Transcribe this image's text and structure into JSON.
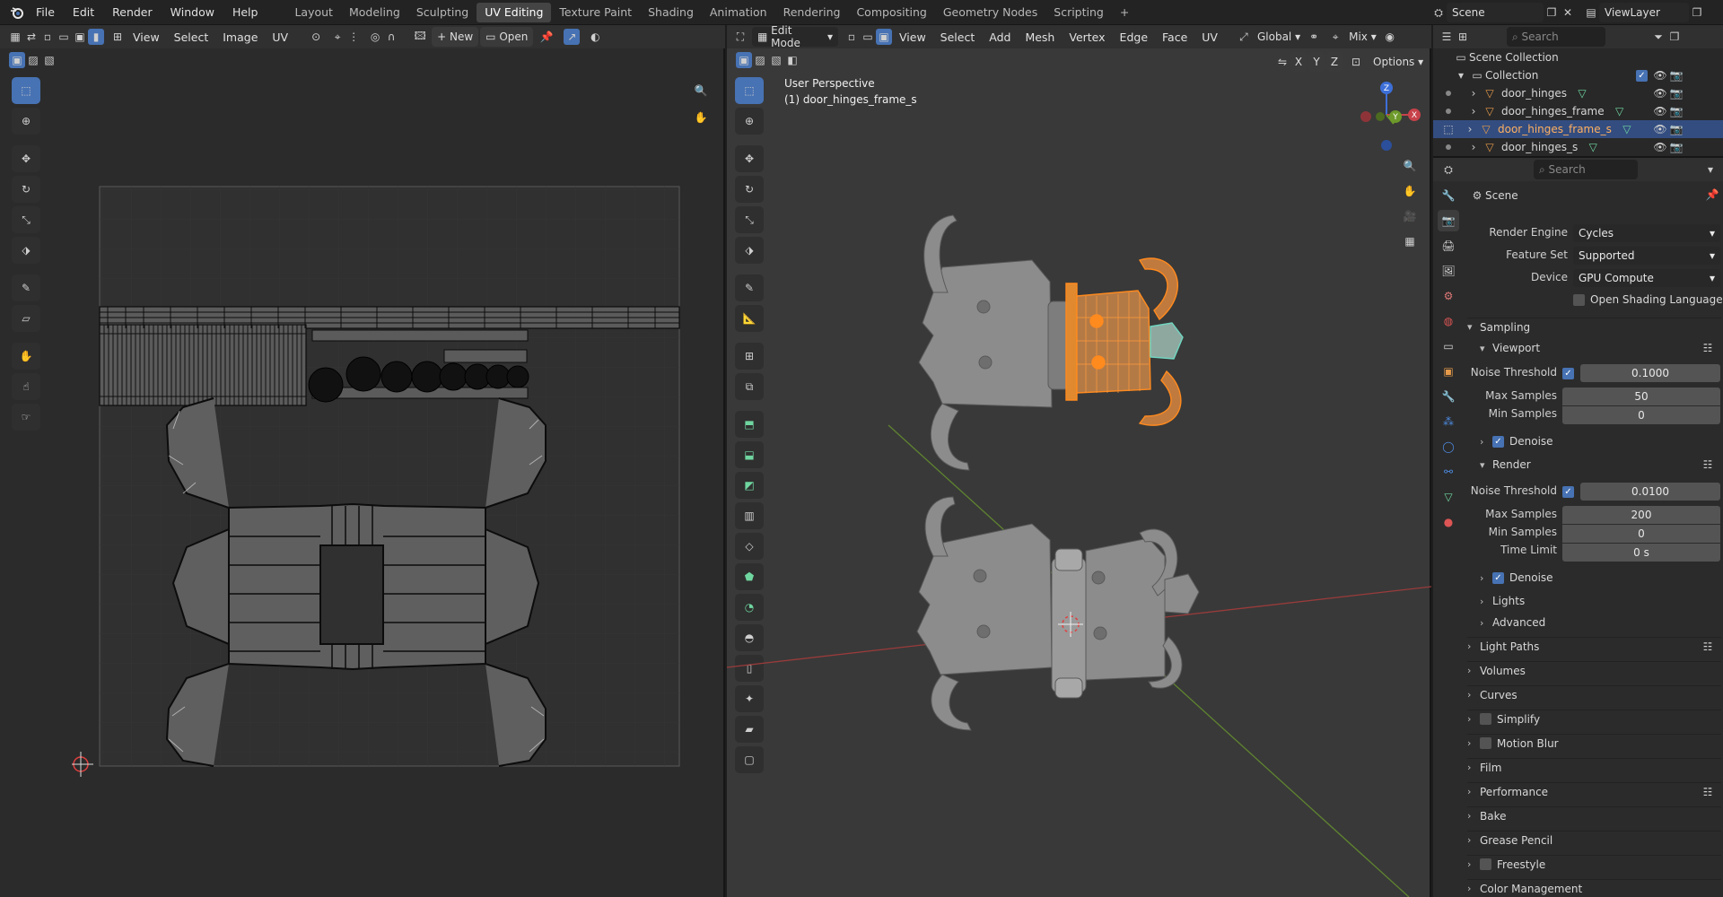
{
  "app": {
    "menus": [
      "File",
      "Edit",
      "Render",
      "Window",
      "Help"
    ],
    "workspaces": [
      "Layout",
      "Modeling",
      "Sculpting",
      "UV Editing",
      "Texture Paint",
      "Shading",
      "Animation",
      "Rendering",
      "Compositing",
      "Geometry Nodes",
      "Scripting"
    ],
    "active_workspace": "UV Editing",
    "scene_name": "Scene",
    "view_layer": "ViewLayer"
  },
  "uv_editor": {
    "menus": [
      "View",
      "Select",
      "Image",
      "UV"
    ],
    "new_label": "New",
    "open_label": "Open"
  },
  "viewport": {
    "mode": "Edit Mode",
    "menus": [
      "View",
      "Select",
      "Add",
      "Mesh",
      "Vertex",
      "Edge",
      "Face",
      "UV"
    ],
    "orientation": "Global",
    "shading": "Mix",
    "options_label": "Options",
    "axis_x": "X",
    "axis_y": "Y",
    "axis_z": "Z",
    "overlay_line1": "User Perspective",
    "overlay_line2": "(1) door_hinges_frame_s"
  },
  "outliner": {
    "search_placeholder": "Search",
    "root": "Scene Collection",
    "collection": "Collection",
    "items": [
      {
        "name": "door_hinges",
        "selected": false
      },
      {
        "name": "door_hinges_frame",
        "selected": false
      },
      {
        "name": "door_hinges_frame_s",
        "selected": true
      },
      {
        "name": "door_hinges_s",
        "selected": false
      }
    ]
  },
  "properties": {
    "search_placeholder": "Search",
    "context": "Scene",
    "render_engine_label": "Render Engine",
    "render_engine": "Cycles",
    "feature_set_label": "Feature Set",
    "feature_set": "Supported",
    "device_label": "Device",
    "device": "GPU Compute",
    "osl_label": "Open Shading Language",
    "sampling": "Sampling",
    "viewport_section": "Viewport",
    "render_section": "Render",
    "noise_threshold_label": "Noise Threshold",
    "max_samples_label": "Max Samples",
    "min_samples_label": "Min Samples",
    "time_limit_label": "Time Limit",
    "denoise_label": "Denoise",
    "viewport_noise": "0.1000",
    "viewport_max": "50",
    "viewport_min": "0",
    "render_noise": "0.0100",
    "render_max": "200",
    "render_min": "0",
    "render_time_limit": "0 s",
    "lights": "Lights",
    "advanced": "Advanced",
    "panels": [
      "Light Paths",
      "Volumes",
      "Curves",
      "Simplify",
      "Motion Blur",
      "Film",
      "Performance",
      "Bake",
      "Grease Pencil",
      "Freestyle",
      "Color Management"
    ]
  },
  "colors": {
    "accent": "#4772b3",
    "selection": "#ff8a1e",
    "active_face": "#6fd6c0",
    "axis_x": "#c7424a",
    "axis_y": "#6d9a2a",
    "axis_z": "#3d6fd8"
  }
}
